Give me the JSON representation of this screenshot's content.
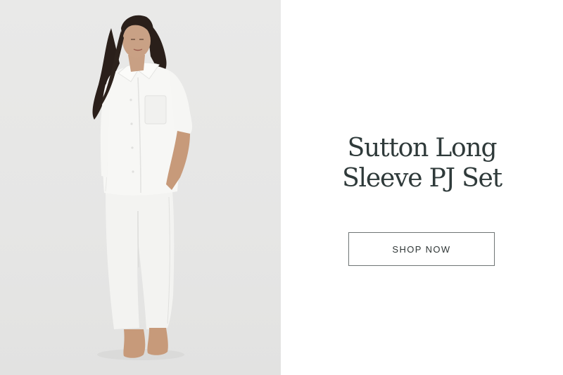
{
  "product": {
    "title_line_1": "Sutton Long",
    "title_line_2": "Sleeve PJ Set",
    "image_subject": "model-in-white-pj-set"
  },
  "cta": {
    "label": "SHOP NOW"
  },
  "colors": {
    "photo_background": "#e7e7e6",
    "page_background": "#ffffff",
    "headline_text": "#2f3a3a",
    "button_border": "#6f7575",
    "button_text": "#2f3636"
  }
}
